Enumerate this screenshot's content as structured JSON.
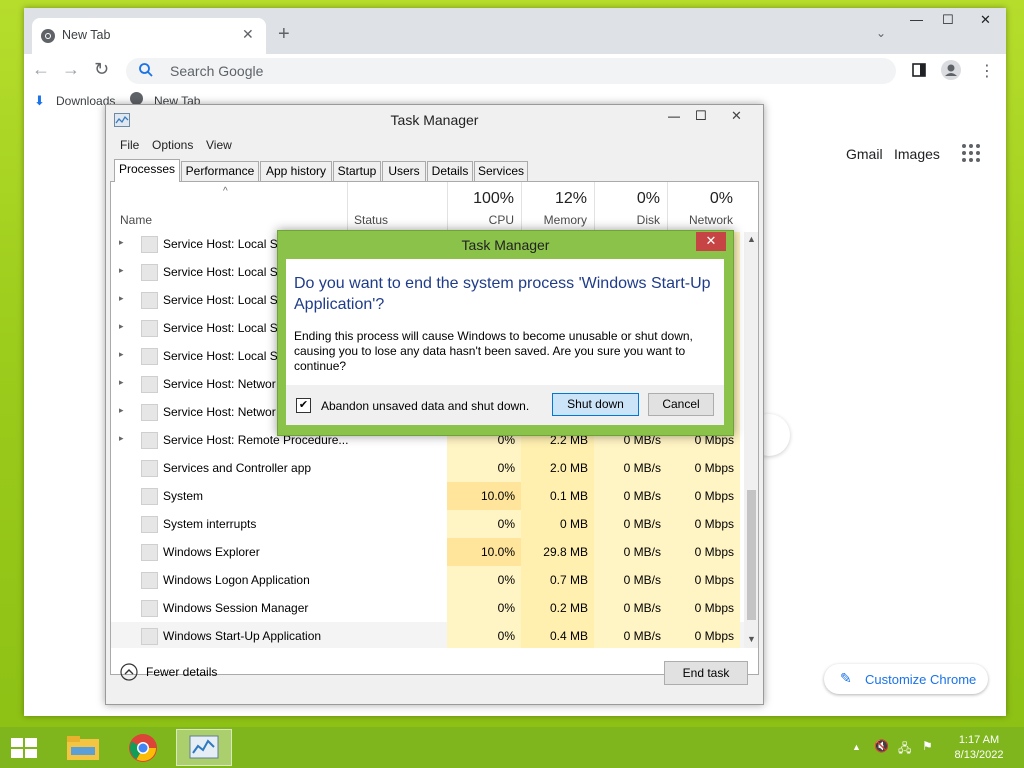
{
  "chrome": {
    "tab_title": "New Tab",
    "search_placeholder": "Search Google",
    "bookmarks": [
      "Downloads",
      "New Tab"
    ],
    "ntp_links": {
      "gmail": "Gmail",
      "images": "Images"
    },
    "customize_label": "Customize Chrome",
    "icons": [
      "back-icon",
      "forward-icon",
      "reload-icon",
      "search-icon",
      "sidepanel-icon",
      "profile-icon",
      "menu-icon",
      "apps-grid-icon",
      "pencil-icon"
    ]
  },
  "task_manager": {
    "title": "Task Manager",
    "menu": [
      "File",
      "Options",
      "View"
    ],
    "tabs": [
      "Processes",
      "Performance",
      "App history",
      "Startup",
      "Users",
      "Details",
      "Services"
    ],
    "active_tab": "Processes",
    "columns": {
      "name": "Name",
      "status": "Status",
      "cpu": {
        "pct": "100%",
        "label": "CPU"
      },
      "memory": {
        "pct": "12%",
        "label": "Memory"
      },
      "disk": {
        "pct": "0%",
        "label": "Disk"
      },
      "network": {
        "pct": "0%",
        "label": "Network"
      }
    },
    "rows": [
      {
        "name": "Service Host: Local Se",
        "expand": true,
        "cpu": "",
        "mem": "",
        "disk": "",
        "net": ""
      },
      {
        "name": "Service Host: Local Se",
        "expand": true,
        "cpu": "",
        "mem": "",
        "disk": "",
        "net": ""
      },
      {
        "name": "Service Host: Local Se",
        "expand": true,
        "cpu": "",
        "mem": "",
        "disk": "",
        "net": ""
      },
      {
        "name": "Service Host: Local Sy",
        "expand": true,
        "cpu": "",
        "mem": "",
        "disk": "",
        "net": ""
      },
      {
        "name": "Service Host: Local Sy",
        "expand": true,
        "cpu": "",
        "mem": "",
        "disk": "",
        "net": ""
      },
      {
        "name": "Service Host: Networ",
        "expand": true,
        "cpu": "",
        "mem": "",
        "disk": "",
        "net": ""
      },
      {
        "name": "Service Host: Networ",
        "expand": true,
        "cpu": "",
        "mem": "",
        "disk": "",
        "net": ""
      },
      {
        "name": "Service Host: Remote Procedure...",
        "expand": true,
        "cpu": "0%",
        "mem": "2.2 MB",
        "disk": "0 MB/s",
        "net": "0 Mbps"
      },
      {
        "name": "Services and Controller app",
        "expand": false,
        "cpu": "0%",
        "mem": "2.0 MB",
        "disk": "0 MB/s",
        "net": "0 Mbps"
      },
      {
        "name": "System",
        "expand": false,
        "cpu": "10.0%",
        "mem": "0.1 MB",
        "disk": "0 MB/s",
        "net": "0 Mbps",
        "hot": true
      },
      {
        "name": "System interrupts",
        "expand": false,
        "cpu": "0%",
        "mem": "0 MB",
        "disk": "0 MB/s",
        "net": "0 Mbps"
      },
      {
        "name": "Windows Explorer",
        "expand": false,
        "cpu": "10.0%",
        "mem": "29.8 MB",
        "disk": "0 MB/s",
        "net": "0 Mbps",
        "hot": true
      },
      {
        "name": "Windows Logon Application",
        "expand": false,
        "cpu": "0%",
        "mem": "0.7 MB",
        "disk": "0 MB/s",
        "net": "0 Mbps"
      },
      {
        "name": "Windows Session Manager",
        "expand": false,
        "cpu": "0%",
        "mem": "0.2 MB",
        "disk": "0 MB/s",
        "net": "0 Mbps"
      },
      {
        "name": "Windows Start-Up Application",
        "expand": false,
        "cpu": "0%",
        "mem": "0.4 MB",
        "disk": "0 MB/s",
        "net": "0 Mbps",
        "selected": true
      }
    ],
    "fewer_details": "Fewer details",
    "end_task": "End task"
  },
  "dialog": {
    "title": "Task Manager",
    "question": "Do you want to end the system process 'Windows Start-Up Application'?",
    "description": "Ending this process will cause Windows to become unusable or shut down, causing you to lose any data hasn't been saved. Are you sure you want to continue?",
    "checkbox_label": "Abandon unsaved data and shut down.",
    "checkbox_checked": true,
    "shutdown_label": "Shut down",
    "cancel_label": "Cancel"
  },
  "taskbar": {
    "time": "1:17 AM",
    "date": "8/13/2022"
  },
  "colors": {
    "desktop": "#9ccc1c",
    "taskbar": "#7fb61e",
    "dialog_frame": "#8bc34a",
    "cpu_cell": "#fff4c4",
    "cpu_cell_hot": "#ffe49c",
    "mem_cell": "#fff0b0",
    "link_blue": "#1a73e8"
  }
}
